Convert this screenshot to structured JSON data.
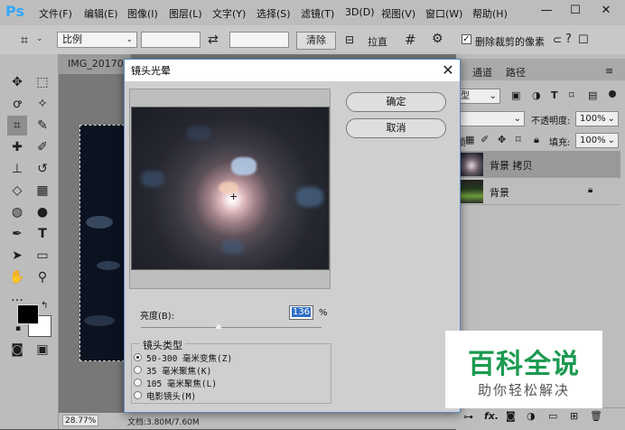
{
  "app": {
    "logo": "Ps",
    "menu": [
      "文件(F)",
      "编辑(E)",
      "图像(I)",
      "图层(L)",
      "文字(Y)",
      "选择(S)",
      "滤镜(T)",
      "3D(D)",
      "视图(V)",
      "窗口(W)",
      "帮助(H)"
    ],
    "window_controls": [
      "—",
      "☐",
      "✕"
    ]
  },
  "options_bar": {
    "ratio_select": "比例",
    "swap_icon": "⇄",
    "clear_button": "清除",
    "straighten_label": "拉直",
    "delete_cropped_label": "删除裁剪的像素",
    "delete_cropped_checked": true
  },
  "document": {
    "tab_label": "IMG_201704",
    "zoom": "28.77%",
    "doc_size": "文档:3.80M/7.60M"
  },
  "panels": {
    "tabs": [
      "通道",
      "路径"
    ],
    "kind_select": "型",
    "opacity_label": "不透明度:",
    "opacity_value": "100%",
    "lock_label": "锁",
    "fill_label": "填充:",
    "fill_value": "100%",
    "layers": [
      {
        "name": "背景 拷贝",
        "selected": true,
        "locked": false
      },
      {
        "name": "背景",
        "selected": false,
        "locked": true
      }
    ],
    "footer_fx": "fx."
  },
  "dialog": {
    "title": "镜头光晕",
    "ok_button": "确定",
    "cancel_button": "取消",
    "brightness_label": "亮度(B):",
    "brightness_value": "136",
    "brightness_unit": "%",
    "brightness_level": 136,
    "lens_group_title": "镜头类型",
    "lens_types": [
      {
        "label": "50-300 毫米变焦(Z)",
        "selected": true
      },
      {
        "label": "35 毫米聚焦(K)",
        "selected": false
      },
      {
        "label": "105 毫米聚焦(L)",
        "selected": false
      },
      {
        "label": "电影镜头(M)",
        "selected": false
      }
    ]
  },
  "watermark": {
    "title": "百科全说",
    "subtitle": "助你轻松解决"
  },
  "colors": {
    "accent": "#31a8ff",
    "watermark_green": "#1b9a50",
    "dialog_border": "#5c88c4"
  }
}
